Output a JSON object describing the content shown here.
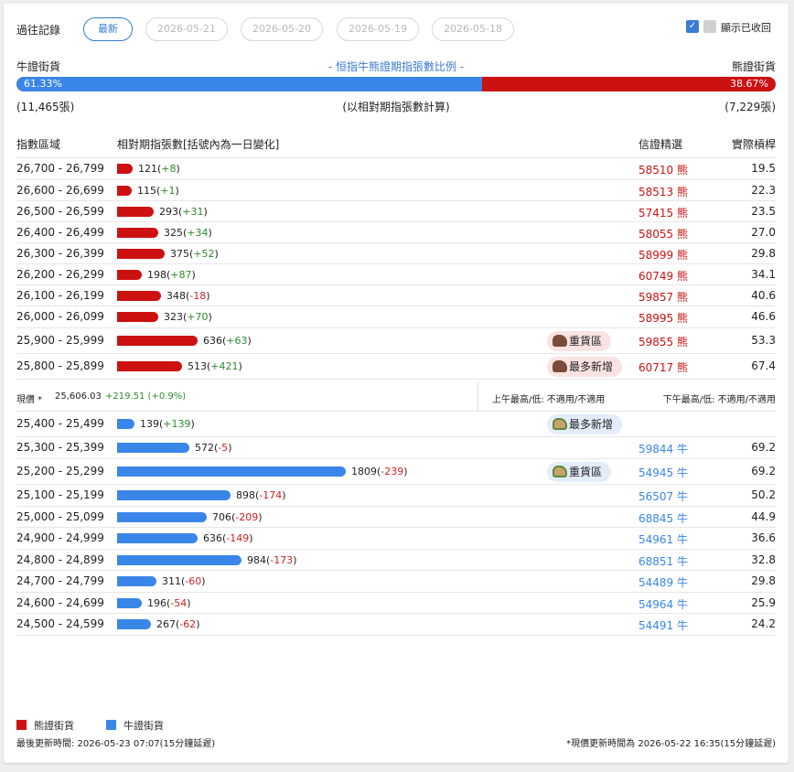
{
  "header": {
    "history_label": "過往記錄",
    "tabs": [
      "最新",
      "2026-05-21",
      "2026-05-20",
      "2026-05-19",
      "2026-05-18"
    ],
    "show_recalled": "顯示已收回",
    "check_mark": "✓"
  },
  "summary": {
    "bull_label": "牛證街貨",
    "bear_label": "熊證街貨",
    "title": "- 恒指牛熊證期指張數比例 -",
    "bull_pct": "61.33%",
    "bear_pct": "38.67%",
    "bull_fraction": 0.6133,
    "bull_count": "(11,465張)",
    "bear_count": "(7,229張)",
    "basis": "(以相對期指張數計算)"
  },
  "table_header": {
    "range": "指數區域",
    "contracts": "相對期指張數[括號內為一日變化]",
    "code": "信證精選",
    "leverage": "實際槓桿"
  },
  "bear_rows": [
    {
      "range": "26,700 - 26,799",
      "val": "121",
      "chg": "+8",
      "code": "58510",
      "tag": "熊",
      "lev": "19.5",
      "n": 121
    },
    {
      "range": "26,600 - 26,699",
      "val": "115",
      "chg": "+1",
      "code": "58513",
      "tag": "熊",
      "lev": "22.3",
      "n": 115
    },
    {
      "range": "26,500 - 26,599",
      "val": "293",
      "chg": "+31",
      "code": "57415",
      "tag": "熊",
      "lev": "23.5",
      "n": 293
    },
    {
      "range": "26,400 - 26,499",
      "val": "325",
      "chg": "+34",
      "code": "58055",
      "tag": "熊",
      "lev": "27.0",
      "n": 325
    },
    {
      "range": "26,300 - 26,399",
      "val": "375",
      "chg": "+52",
      "code": "58999",
      "tag": "熊",
      "lev": "29.8",
      "n": 375
    },
    {
      "range": "26,200 - 26,299",
      "val": "198",
      "chg": "+87",
      "code": "60749",
      "tag": "熊",
      "lev": "34.1",
      "n": 198
    },
    {
      "range": "26,100 - 26,199",
      "val": "348",
      "chg": "-18",
      "code": "59857",
      "tag": "熊",
      "lev": "40.6",
      "n": 348
    },
    {
      "range": "26,000 - 26,099",
      "val": "323",
      "chg": "+70",
      "code": "58995",
      "tag": "熊",
      "lev": "46.6",
      "n": 323
    },
    {
      "range": "25,900 - 25,999",
      "val": "636",
      "chg": "+63",
      "code": "59855",
      "tag": "熊",
      "lev": "53.3",
      "n": 636,
      "zone": "重貨區"
    },
    {
      "range": "25,800 - 25,899",
      "val": "513",
      "chg": "+421",
      "code": "60717",
      "tag": "熊",
      "lev": "67.4",
      "n": 513,
      "zone": "最多新增"
    }
  ],
  "spot": {
    "label": "現價 *",
    "price": "25,606.03",
    "change": "+219.51 (+0.9%)",
    "am": "上午最高/低: 不適用/不適用",
    "pm": "下午最高/低: 不適用/不適用"
  },
  "bull_rows": [
    {
      "range": "25,400 - 25,499",
      "val": "139",
      "chg": "+139",
      "code": "",
      "tag": "",
      "lev": "",
      "n": 139,
      "zone": "最多新增"
    },
    {
      "range": "25,300 - 25,399",
      "val": "572",
      "chg": "-5",
      "code": "59844",
      "tag": "牛",
      "lev": "69.2",
      "n": 572
    },
    {
      "range": "25,200 - 25,299",
      "val": "1809",
      "chg": "-239",
      "code": "54945",
      "tag": "牛",
      "lev": "69.2",
      "n": 1809,
      "zone": "重貨區"
    },
    {
      "range": "25,100 - 25,199",
      "val": "898",
      "chg": "-174",
      "code": "56507",
      "tag": "牛",
      "lev": "50.2",
      "n": 898
    },
    {
      "range": "25,000 - 25,099",
      "val": "706",
      "chg": "-209",
      "code": "68845",
      "tag": "牛",
      "lev": "44.9",
      "n": 706
    },
    {
      "range": "24,900 - 24,999",
      "val": "636",
      "chg": "-149",
      "code": "54961",
      "tag": "牛",
      "lev": "36.6",
      "n": 636
    },
    {
      "range": "24,800 - 24,899",
      "val": "984",
      "chg": "-173",
      "code": "68851",
      "tag": "牛",
      "lev": "32.8",
      "n": 984
    },
    {
      "range": "24,700 - 24,799",
      "val": "311",
      "chg": "-60",
      "code": "54489",
      "tag": "牛",
      "lev": "29.8",
      "n": 311
    },
    {
      "range": "24,600 - 24,699",
      "val": "196",
      "chg": "-54",
      "code": "54964",
      "tag": "牛",
      "lev": "25.9",
      "n": 196
    },
    {
      "range": "24,500 - 24,599",
      "val": "267",
      "chg": "-62",
      "code": "54491",
      "tag": "牛",
      "lev": "24.2",
      "n": 267
    }
  ],
  "legend": {
    "bear": "熊證街貨",
    "bull": "牛證街貨",
    "bear_color": "#cc1111",
    "bull_color": "#3a86e8"
  },
  "footer": {
    "last_update": "最後更新時間: 2026-05-23 07:07(15分鐘延遲)",
    "spot_update": "*現價更新時間為 2026-05-22 16:35(15分鐘延遲)"
  }
}
